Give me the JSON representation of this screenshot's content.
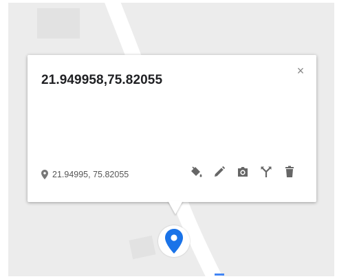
{
  "popup": {
    "title": "21.949958,75.82055",
    "close_label": "×",
    "coordinates": "21.94995, 75.82055"
  },
  "icons": {
    "location": "place-icon",
    "close": "close-icon",
    "style": "paint-bucket-icon",
    "edit": "pencil-icon",
    "photo": "camera-icon",
    "directions": "fork-icon",
    "delete": "trash-icon",
    "marker": "map-marker-icon"
  },
  "colors": {
    "marker": "#1a73e8",
    "icon": "#666666",
    "map_background": "#ececec",
    "road": "#ffffff"
  }
}
